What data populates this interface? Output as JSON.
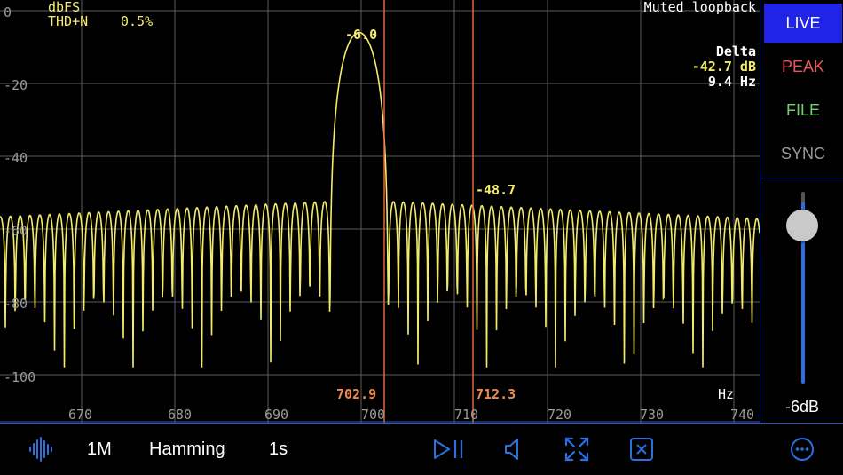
{
  "header": {
    "units_label": "dbFS",
    "thd_label": "THD+N",
    "thd_value": "0.5%",
    "status": "Muted loopback"
  },
  "delta": {
    "title": "Delta",
    "db": "-42.7 dB",
    "hz": "9.4 Hz"
  },
  "markers": {
    "peak_main_label": "-6.0",
    "peak_side_label": "-48.7",
    "cursor_a_label": "702.9",
    "cursor_b_label": "712.3",
    "cursor_a_freq": 702.9,
    "cursor_b_freq": 712.3
  },
  "axes": {
    "y_ticks": [
      "0",
      "-20",
      "-40",
      "-60",
      "-80",
      "-100"
    ],
    "x_ticks": [
      "670",
      "680",
      "690",
      "700",
      "710",
      "720",
      "730",
      "740"
    ],
    "x_unit": "Hz"
  },
  "chart_data": {
    "type": "line",
    "xlabel": "Hz",
    "ylabel": "dbFS",
    "xlim": [
      662.5,
      742
    ],
    "ylim": [
      -102,
      0
    ],
    "main_peak": {
      "x": 701.2,
      "y": -6.0
    },
    "sidelobe_peak": {
      "x": 711.5,
      "y": -48.7
    },
    "series": [
      {
        "values_note": ""
      }
    ]
  },
  "side_panel": {
    "modes": [
      "LIVE",
      "PEAK",
      "FILE",
      "SYNC"
    ],
    "active_mode": "LIVE",
    "gain_label": "-6dB",
    "gain_level": 0.82
  },
  "toolbar": {
    "length_label": "1M",
    "window_label": "Hamming",
    "duration_label": "1s"
  },
  "colors": {
    "trace": "#f3ec6a",
    "cursor": "#e0683a",
    "grid": "#5c5c5c",
    "accent": "#2b6fe0",
    "active_mode_bg": "#1f24e8",
    "peak": "#e8555a",
    "file": "#6fd36a",
    "sync": "#9a9a9a"
  },
  "icons": [
    "waveform-icon",
    "play-pause-icon",
    "speaker-icon",
    "expand-icon",
    "clear-icon",
    "more-icon"
  ]
}
